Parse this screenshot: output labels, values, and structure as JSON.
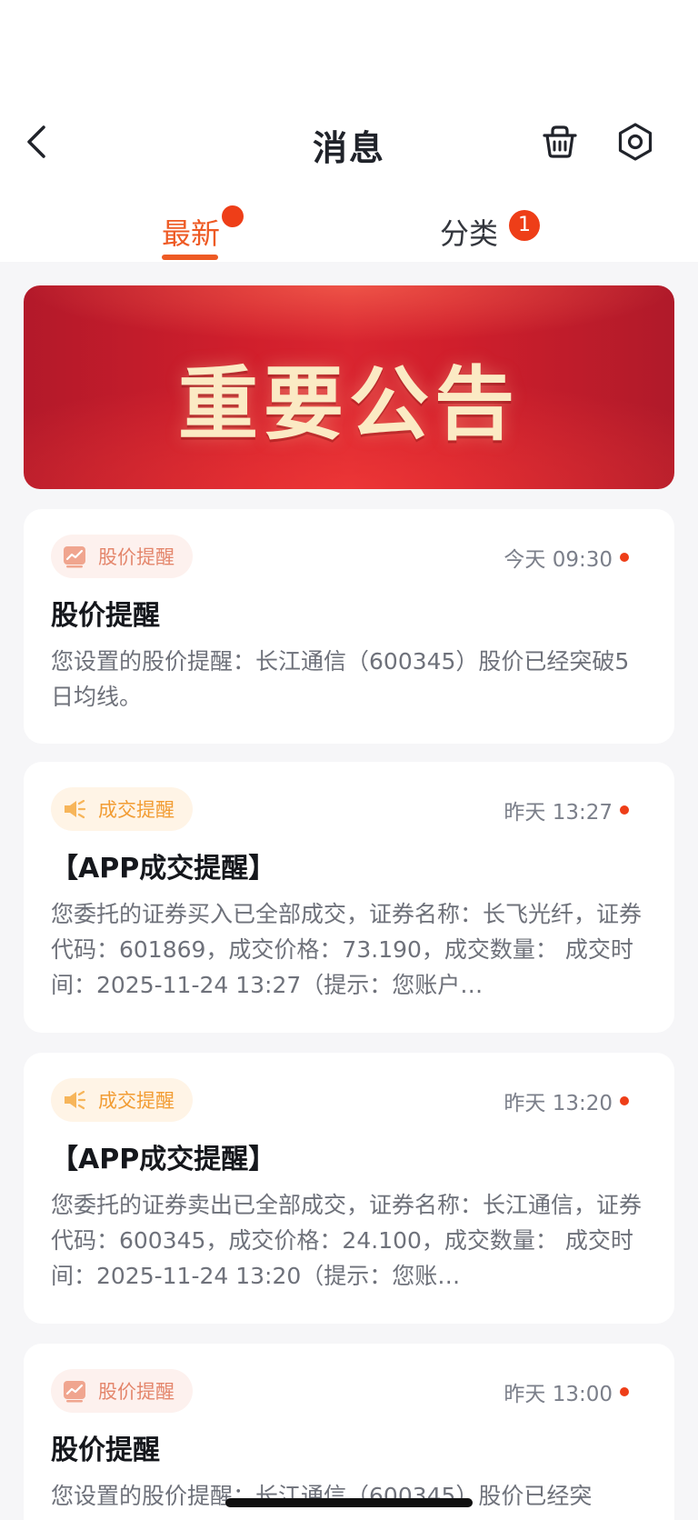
{
  "header": {
    "title": "消息"
  },
  "tabs": [
    {
      "label": "最新",
      "active": true
    },
    {
      "label": "分类",
      "badge": "1"
    }
  ],
  "banner": {
    "text": "重要公告"
  },
  "messages": [
    {
      "tag": "股价提醒",
      "tag_icon": "chart-icon",
      "time": "今天 09:30",
      "title": "股价提醒",
      "body": "您设置的股价提醒：长江通信（600345）股价已经突破5日均线。"
    },
    {
      "tag": "成交提醒",
      "tag_icon": "megaphone-icon",
      "time": "昨天 13:27",
      "title": "【APP成交提醒】",
      "body": "您委托的证券买入已全部成交，证券名称：长飞光纤，证券代码：601869，成交价格：73.190，成交数量：   成交时间：2025-11-24 13:27（提示：您账户…"
    },
    {
      "tag": "成交提醒",
      "tag_icon": "megaphone-icon",
      "time": "昨天 13:20",
      "title": "【APP成交提醒】",
      "body": "您委托的证券卖出已全部成交，证券名称：长江通信，证券代码：600345，成交价格：24.100，成交数量：   成交时间：2025-11-24 13:20（提示：您账…"
    },
    {
      "tag": "股价提醒",
      "tag_icon": "chart-icon",
      "time": "昨天 13:00",
      "title": "股价提醒",
      "body": "您设置的股价提醒：长江通信（600345）股价已经突"
    }
  ],
  "colors": {
    "accent": "#ee5a24",
    "unread": "#ee3e18",
    "banner": "#d11f2c"
  }
}
